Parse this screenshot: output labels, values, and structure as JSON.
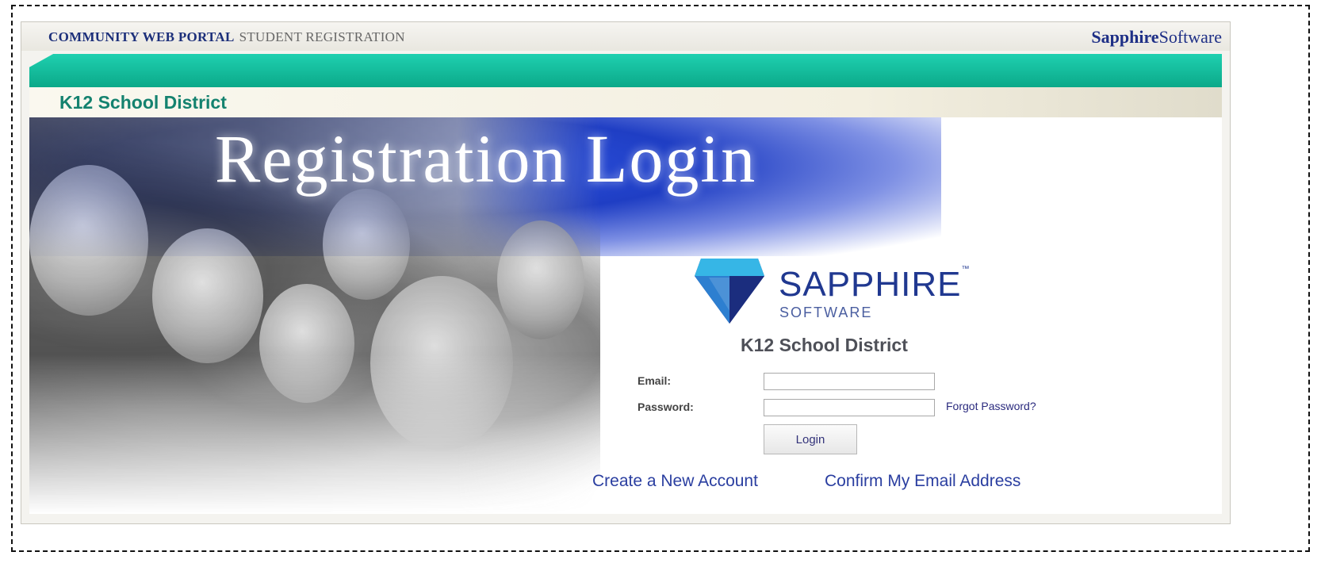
{
  "header": {
    "portal_title": "COMMUNITY WEB PORTAL",
    "portal_subtitle": "STUDENT REGISTRATION",
    "brand_bold": "Sapphire",
    "brand_rest": "Software"
  },
  "district_band": {
    "label": "K12 School District"
  },
  "hero": {
    "title": "Registration Login"
  },
  "logo": {
    "word": "SAPPHIRE",
    "tm": "™",
    "sub": "SOFTWARE"
  },
  "login": {
    "district": "K12 School District",
    "email_label": "Email:",
    "email_value": "",
    "password_label": "Password:",
    "password_value": "",
    "forgot_label": "Forgot Password?",
    "login_label": "Login"
  },
  "links": {
    "create_account": "Create a New Account",
    "confirm_email": "Confirm My Email Address"
  },
  "colors": {
    "teal": "#0ba989",
    "navy": "#1c2f7a",
    "hero_blue": "#1f3ec4",
    "gem_light": "#36b6e6",
    "gem_dark": "#203890"
  },
  "icons": {
    "brand_logo": "sapphire-gem-logo"
  }
}
